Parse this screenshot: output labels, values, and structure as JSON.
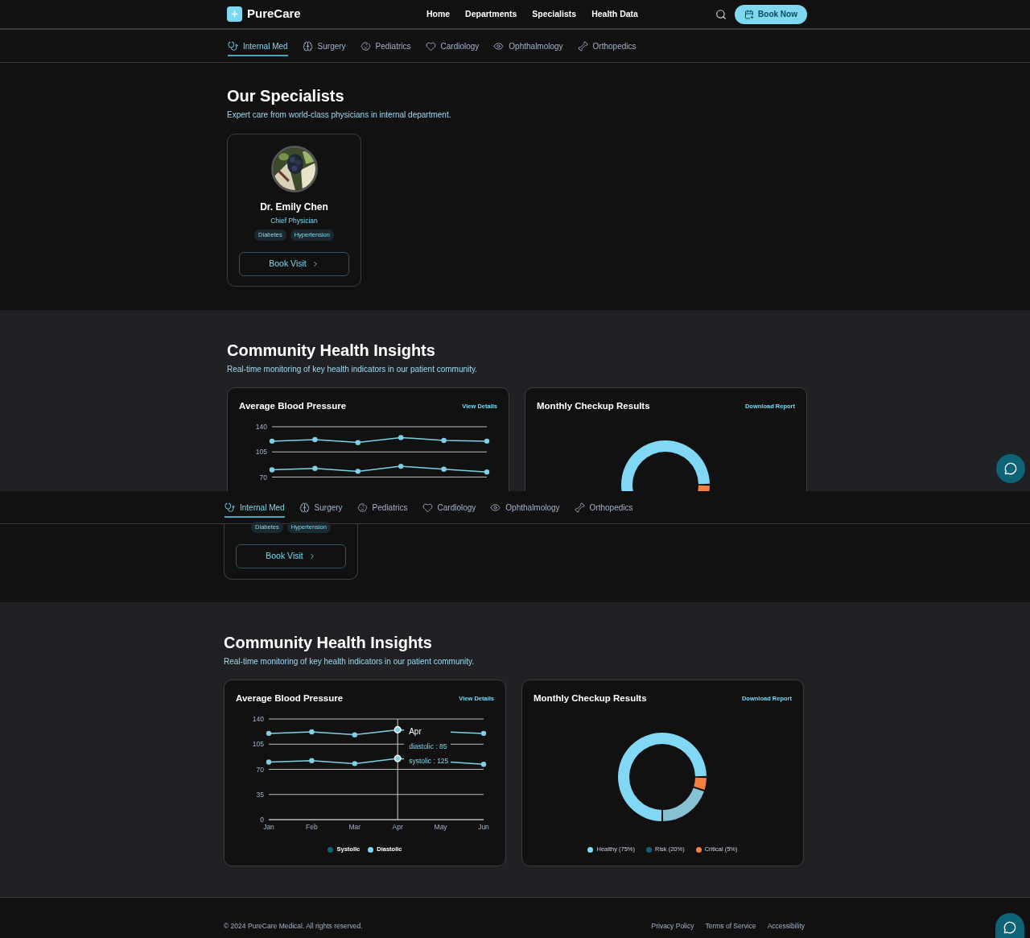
{
  "top_view": {
    "header": {
      "logo": "PureCare",
      "nav": [
        "Home",
        "Departments",
        "Specialists",
        "Health Data"
      ],
      "cta": "Book Now"
    },
    "tabs": [
      {
        "label": "Internal Med",
        "selected": true
      },
      {
        "label": "Surgery",
        "selected": false
      },
      {
        "label": "Pediatrics",
        "selected": false
      },
      {
        "label": "Cardiology",
        "selected": false
      },
      {
        "label": "Ophthalmology",
        "selected": false
      },
      {
        "label": "Orthopedics",
        "selected": false
      }
    ],
    "specialists": {
      "title": "Our Specialists",
      "subtitle": "Expert care from world-class physicians in internal department.",
      "doctors": [
        {
          "name": "Dr. Emily Chen",
          "role": "Chief Physician",
          "tags": [
            "Diabetes",
            "Hypertension"
          ],
          "button": "Book Visit"
        }
      ]
    },
    "insights": {
      "title": "Community Health Insights",
      "subtitle": "Real-time monitoring of key health indicators in our patient community.",
      "bp_card": {
        "title": "Average Blood Pressure",
        "link": "View Details",
        "chart_data": {
          "type": "line",
          "ylim": [
            70,
            140
          ],
          "yticks": [
            70,
            105,
            140
          ],
          "grid": true,
          "series": [
            {
              "color": "#7fd0e6",
              "marker": "o",
              "values": [
                120,
                122,
                118,
                125,
                121,
                120
              ]
            },
            {
              "color": "#7fd0e6",
              "marker": "o",
              "values": [
                80,
                82,
                78,
                85,
                81,
                77
              ]
            }
          ]
        }
      },
      "checkup_card": {
        "title": "Monthly Checkup Results",
        "link": "Download Report"
      }
    }
  },
  "bottom_view": {
    "tabs": [
      {
        "label": "Internal Med",
        "selected": true
      },
      {
        "label": "Surgery",
        "selected": false
      },
      {
        "label": "Pediatrics",
        "selected": false
      },
      {
        "label": "Cardiology",
        "selected": false
      },
      {
        "label": "Ophthalmology",
        "selected": false
      },
      {
        "label": "Orthopedics",
        "selected": false
      }
    ],
    "doctor_tags": [
      "Diabetes",
      "Hypertension"
    ],
    "doctor_button": "Book Visit",
    "insights": {
      "title": "Community Health Insights",
      "subtitle": "Real-time monitoring of key health indicators in our patient community.",
      "bp_card": {
        "title": "Average Blood Pressure",
        "link": "View Details",
        "chart_data": {
          "type": "line",
          "categories": [
            "Jan",
            "Feb",
            "Mar",
            "Apr",
            "May",
            "Jun"
          ],
          "ylim": [
            0,
            140
          ],
          "yticks": [
            0,
            35,
            70,
            105,
            140
          ],
          "grid": true,
          "series": [
            {
              "color": "#7fd0e6",
              "marker": "o",
              "values": [
                120,
                122,
                118,
                125,
                null,
                120
              ]
            },
            {
              "color": "#7fd0e6",
              "marker": "o",
              "values": [
                80,
                82,
                78,
                85,
                null,
                77
              ]
            }
          ],
          "ref_lines": [
            {
              "axis": "x",
              "value": "Apr",
              "color": "#cfcfcf"
            }
          ]
        },
        "tooltip": {
          "title": "Apr",
          "lines": [
            "diastolic : 85",
            "systolic : 125"
          ]
        },
        "legend": [
          {
            "label": "Systolic",
            "color": "#0e6377"
          },
          {
            "label": "Diastolic",
            "color": "#7dd8f0"
          }
        ]
      },
      "checkup_card": {
        "title": "Monthly Checkup Results",
        "link": "Download Report",
        "chart_data": {
          "type": "donut",
          "categories": [
            "Healthy (75%)",
            "Risk (20%)",
            "Critical (5%)"
          ],
          "values": [
            75,
            20,
            5
          ],
          "colors": [
            "#81d8f5",
            "#86c1d4",
            "#f47f3f"
          ]
        },
        "legend": [
          {
            "color": "#81d8f5"
          },
          {
            "color": "#0e6377"
          },
          {
            "color": "#f47f3f"
          }
        ]
      }
    },
    "footer": {
      "copyright": "© 2024 PureCare Medical. All rights reserved.",
      "links": [
        "Privacy Policy",
        "Terms of Service",
        "Accessibility"
      ]
    }
  }
}
